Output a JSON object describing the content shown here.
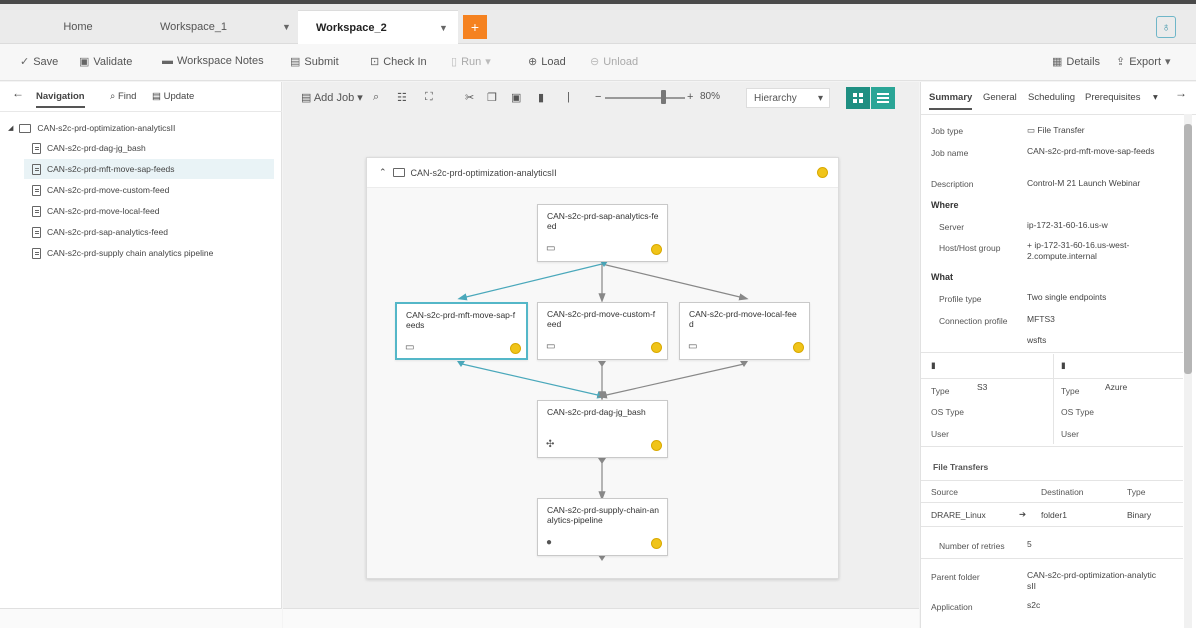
{
  "tabs": [
    {
      "label": "Home"
    },
    {
      "label": "Workspace_1"
    },
    {
      "label": "Workspace_2"
    }
  ],
  "add_tab": "+",
  "toolbar": {
    "save": "Save",
    "validate": "Validate",
    "workspace_notes": "Workspace Notes",
    "submit": "Submit",
    "check_in": "Check In",
    "run": "Run",
    "load": "Load",
    "unload": "Unload",
    "details": "Details",
    "export": "Export"
  },
  "left": {
    "tabs": {
      "navigation": "Navigation",
      "find": "Find",
      "update": "Update"
    },
    "tree": [
      {
        "label": "CAN-s2c-prd-optimization-analyticsII",
        "kind": "folder"
      },
      {
        "label": "CAN-s2c-prd-dag-jg_bash",
        "kind": "file"
      },
      {
        "label": "CAN-s2c-prd-mft-move-sap-feeds",
        "kind": "file"
      },
      {
        "label": "CAN-s2c-prd-move-custom-feed",
        "kind": "file"
      },
      {
        "label": "CAN-s2c-prd-move-local-feed",
        "kind": "file"
      },
      {
        "label": "CAN-s2c-prd-sap-analytics-feed",
        "kind": "file"
      },
      {
        "label": "CAN-s2c-prd-supply chain analytics pipeline",
        "kind": "file"
      }
    ]
  },
  "canvas": {
    "add_job": "Add Job",
    "zoom": "80%",
    "view": "Hierarchy",
    "folder_title": "CAN-s2c-prd-optimization-analyticsII",
    "nodes": {
      "sap": "CAN-s2c-prd-sap-analytics-feed",
      "mft": "CAN-s2c-prd-mft-move-sap-feeds",
      "custom": "CAN-s2c-prd-move-custom-feed",
      "local": "CAN-s2c-prd-move-local-feed",
      "dag": "CAN-s2c-prd-dag-jg_bash",
      "supply": "CAN-s2c-prd-supply-chain-analytics-pipeline"
    }
  },
  "right": {
    "tabs": {
      "summary": "Summary",
      "general": "General",
      "scheduling": "Scheduling",
      "prerequisites": "Prerequisites"
    },
    "job_type_label": "Job type",
    "job_type": "File Transfer",
    "job_name_label": "Job name",
    "job_name": "CAN-s2c-prd-mft-move-sap-feeds",
    "description_label": "Description",
    "description": "Control-M 21 Launch Webinar",
    "where": "Where",
    "server_label": "Server",
    "server": "ip-172-31-60-16.us-w",
    "host_label": "Host/Host group",
    "host": "+ ip-172-31-60-16.us-west-2.compute.internal",
    "what": "What",
    "profile_type_label": "Profile type",
    "profile_type": "Two single endpoints",
    "conn_profile_label": "Connection profile",
    "conn_profile": "MFTS3",
    "conn_profile_2": "wsfts",
    "ep1_type_label": "Type",
    "ep1_type": "S3",
    "ep2_type_label": "Type",
    "ep2_type": "Azure",
    "os_type_label": "OS Type",
    "user_label": "User",
    "file_transfers": "File Transfers",
    "col_source": "Source",
    "col_destination": "Destination",
    "col_type": "Type",
    "row_source": "DRARE_Linux",
    "row_destination": "folder1",
    "row_type": "Binary",
    "retries_label": "Number of retries",
    "retries": "5",
    "parent_label": "Parent folder",
    "parent": "CAN-s2c-prd-optimization-analyticsII",
    "application_label": "Application",
    "application": "s2c"
  },
  "colors": {
    "accent": "#54b7c8",
    "orange": "#f58220",
    "view_active": "#1f8f82",
    "status_dot": "#f0c419"
  }
}
